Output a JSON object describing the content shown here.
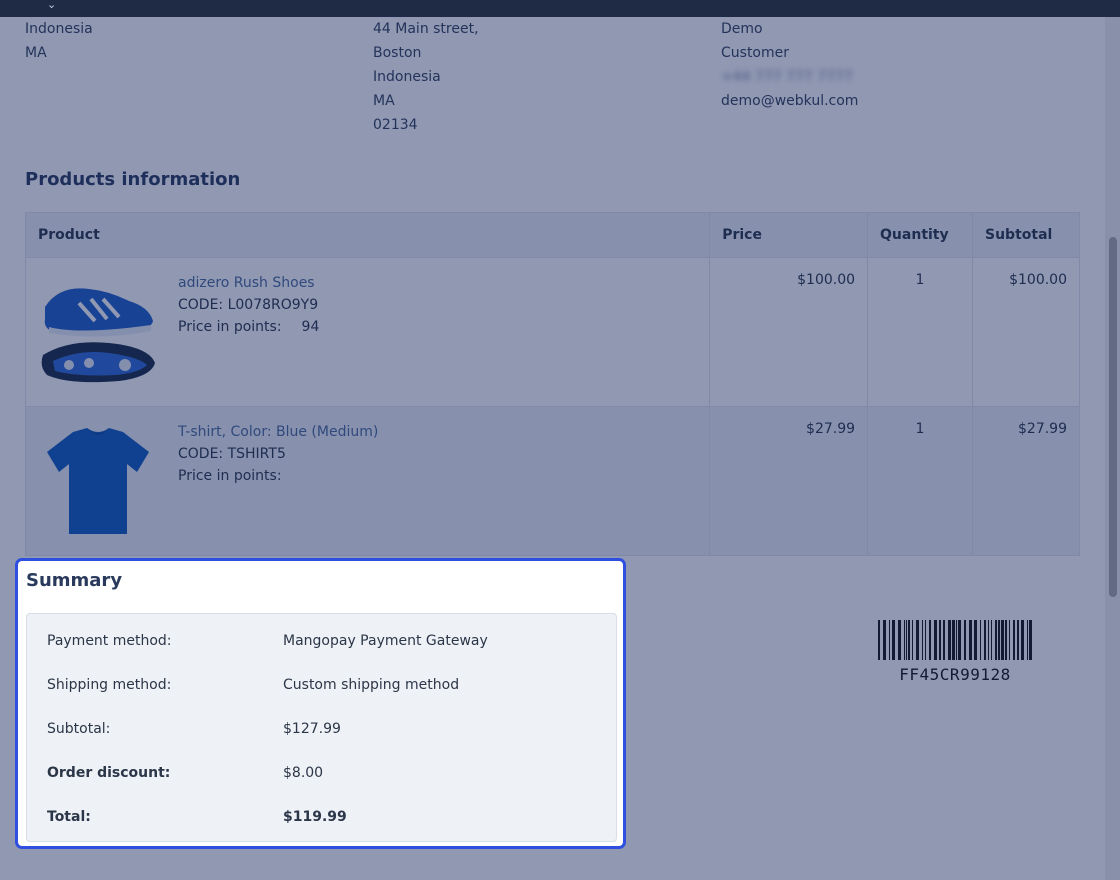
{
  "addresses": {
    "col1": [
      "Indonesia",
      "MA"
    ],
    "col2": [
      "44 Main street,",
      "Boston",
      "Indonesia",
      "MA",
      "02134"
    ],
    "col3": {
      "first_name": "Demo",
      "last_name": "Customer",
      "phone": "+44 777 777 7777",
      "email": "demo@webkul.com"
    }
  },
  "products_section": {
    "title": "Products information",
    "headers": [
      "Product",
      "Price",
      "Quantity",
      "Subtotal"
    ],
    "rows": [
      {
        "name": "adizero Rush Shoes",
        "code": "CODE: L0078RO9Y9",
        "points_label": "Price in points:",
        "points_value": "94",
        "price": "$100.00",
        "quantity": "1",
        "subtotal": "$100.00",
        "icon": "shoe-image"
      },
      {
        "name": "T-shirt, Color: Blue (Medium)",
        "code": "CODE: TSHIRT5",
        "points_label": "Price in points:",
        "points_value": "",
        "price": "$27.99",
        "quantity": "1",
        "subtotal": "$27.99",
        "icon": "tshirt-image"
      }
    ]
  },
  "summary": {
    "title": "Summary",
    "rows": [
      {
        "label": "Payment method:",
        "value": "Mangopay Payment Gateway"
      },
      {
        "label": "Shipping method:",
        "value": "Custom shipping method"
      },
      {
        "label": "Subtotal:",
        "value": "$127.99"
      },
      {
        "label": "Order discount:",
        "value": "$8.00"
      },
      {
        "label": "Total:",
        "value": "$119.99"
      }
    ]
  },
  "barcode": {
    "code": "FF45CR99128"
  },
  "colors": {
    "overlay": "#14245c",
    "highlight_border": "#2f4fe0",
    "top_bar": "#1f2a44"
  }
}
